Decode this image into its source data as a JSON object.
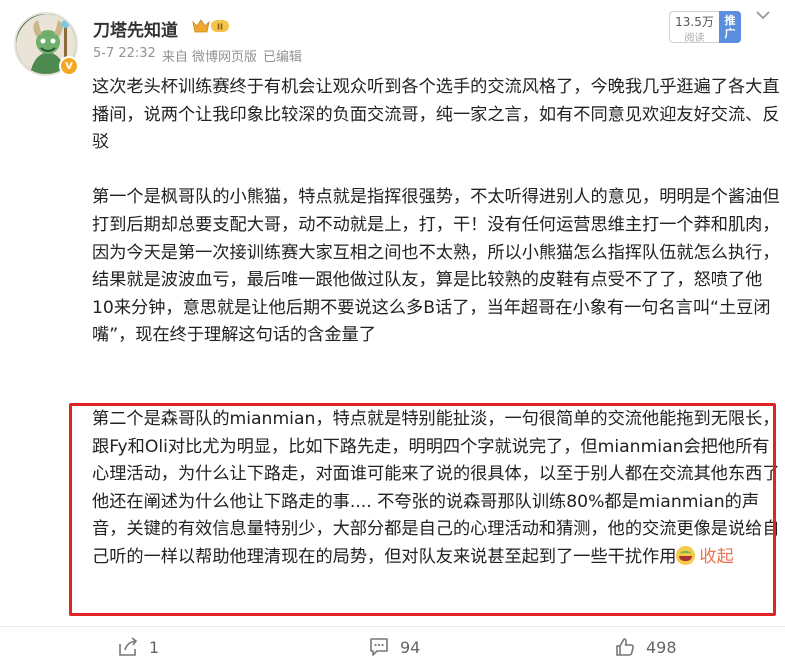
{
  "user": {
    "name": "刀塔先知道",
    "vip_level": "II",
    "verified_badge": "V"
  },
  "post_meta": {
    "time": "5-7 22:32",
    "source": "来自 微博网页版",
    "edited": "已编辑"
  },
  "read_count": {
    "value": "13.5万",
    "label": "阅读"
  },
  "promote": {
    "label_line1": "推",
    "label_line2": "广"
  },
  "post": {
    "paragraphs": [
      "这次老头杯训练赛终于有机会让观众听到各个选手的交流风格了，今晚我几乎逛遍了各大直播间，说两个让我印象比较深的负面交流哥，纯一家之言，如有不同意见欢迎友好交流、反驳",
      "第一个是枫哥队的小熊猫，特点就是指挥很强势，不太听得进别人的意见，明明是个酱油但打到后期却总要支配大哥，动不动就是上，打，干！没有任何运营思维主打一个莽和肌肉，因为今天是第一次接训练赛大家互相之间也不太熟，所以小熊猫怎么指挥队伍就怎么执行，结果就是波波血亏，最后唯一跟他做过队友，算是比较熟的皮鞋有点受不了了，怒喷了他10来分钟，意思就是让他后期不要说这么多B话了，当年超哥在小象有一句名言叫“土豆闭嘴”，现在终于理解这句话的含金量了",
      "第二个是森哥队的mianmian，特点就是特别能扯淡，一句很简单的交流他能拖到无限长，跟Fy和Oli对比尤为明显，比如下路先走，明明四个字就说完了，但mianmian会把他所有心理活动，为什么让下路走，对面谁可能来了说的很具体，以至于别人都在交流其他东西了他还在阐述为什么他让下路走的事.... 不夸张的说森哥那队训练80%都是mianmian的声音，关键的有效信息量特别少，大部分都是自己的心理活动和猜测，他的交流更像是说给自己听的一样以帮助他理清现在的局势，但对队友来说甚至起到了一些干扰作用"
    ],
    "emoji": "laugh-cry-emoji",
    "collapse_label": "收起"
  },
  "actions": {
    "share_count": "1",
    "comment_count": "94",
    "like_count": "498"
  },
  "colors": {
    "link": "#eb7350",
    "highlight_border": "#e02424",
    "promote_bg": "#5b8ede",
    "meta_text": "#939393"
  }
}
